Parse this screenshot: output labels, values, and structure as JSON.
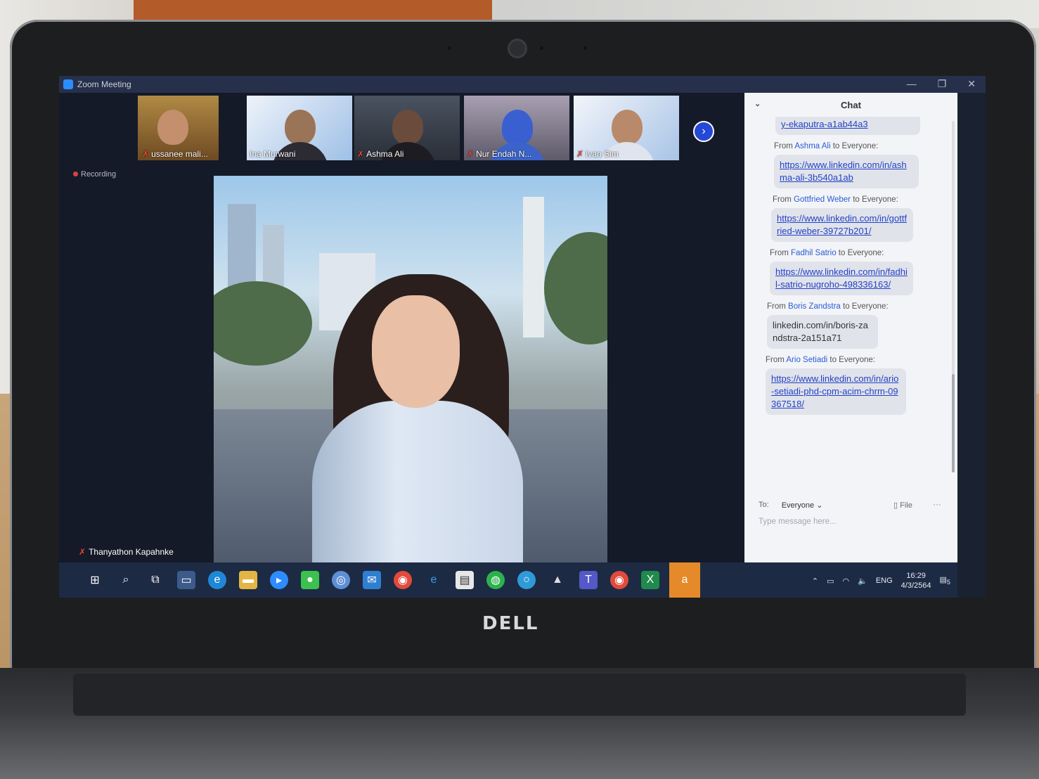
{
  "window": {
    "title": "Zoom Meeting",
    "minimize": "—",
    "maximize": "❐",
    "close": "✕"
  },
  "recording": "Recording",
  "participants": [
    {
      "name": "ussanee mali..."
    },
    {
      "name": "Ina Murwani"
    },
    {
      "name": "Ashma Ali"
    },
    {
      "name": "Nur Endah N..."
    },
    {
      "name": "Ivan Sim"
    }
  ],
  "next_page": "›",
  "self_name": "Thanyathon Kapahnke",
  "chat": {
    "title": "Chat",
    "collapse": "⌄",
    "messages": [
      {
        "from": "",
        "text": "y-ekaputra-a1ab44a3",
        "link": true
      },
      {
        "from_name": "Ashma Ali",
        "from_suffix": " to Everyone:",
        "text": "https://www.linkedin.com/in/ashma-ali-3b540a1ab",
        "link": true
      },
      {
        "from_name": "Gottfried Weber",
        "from_suffix": " to Everyone:",
        "text": "https://www.linkedin.com/in/gottfried-weber-39727b201/",
        "link": true
      },
      {
        "from_name": "Fadhil Satrio",
        "from_suffix": " to Everyone:",
        "text": "https://www.linkedin.com/in/fadhil-satrio-nugroho-498336163/",
        "link": true
      },
      {
        "from_name": "Boris Zandstra",
        "from_suffix": " to Everyone:",
        "text": "linkedin.com/in/boris-zandstra-2a151a71",
        "link": false
      },
      {
        "from_name": "Ario Setiadi",
        "from_suffix": " to Everyone:",
        "text": "https://www.linkedin.com/in/ario-setiadi-phd-cpm-acim-chrm-09367518/",
        "link": true
      }
    ],
    "from_prefix": "From ",
    "to_label": "To:",
    "to_value": "Everyone ⌄",
    "file_label": "File",
    "more": "···",
    "input_placeholder": "Type message here..."
  },
  "taskbar": {
    "icons": [
      "windows-start-icon",
      "search-icon",
      "task-view-icon",
      "desktop-icon",
      "edge-icon",
      "file-explorer-icon",
      "zoom-icon",
      "line-icon",
      "network-icon",
      "mail-icon",
      "chrome-icon",
      "internet-explorer-icon",
      "store-icon",
      "wechat-icon",
      "app-icon",
      "acrobat-icon",
      "teams-icon",
      "chrome-icon",
      "excel-icon",
      "avast-icon"
    ],
    "lang": "ENG",
    "time": "16:29",
    "date": "4/3/2564",
    "notifications": "5"
  },
  "brand": "DELL",
  "colors": {
    "zoom_blue": "#2d8cff",
    "taskbar": "#1d2a44",
    "chat_bg": "#f3f4f7",
    "link": "#2243c8"
  }
}
